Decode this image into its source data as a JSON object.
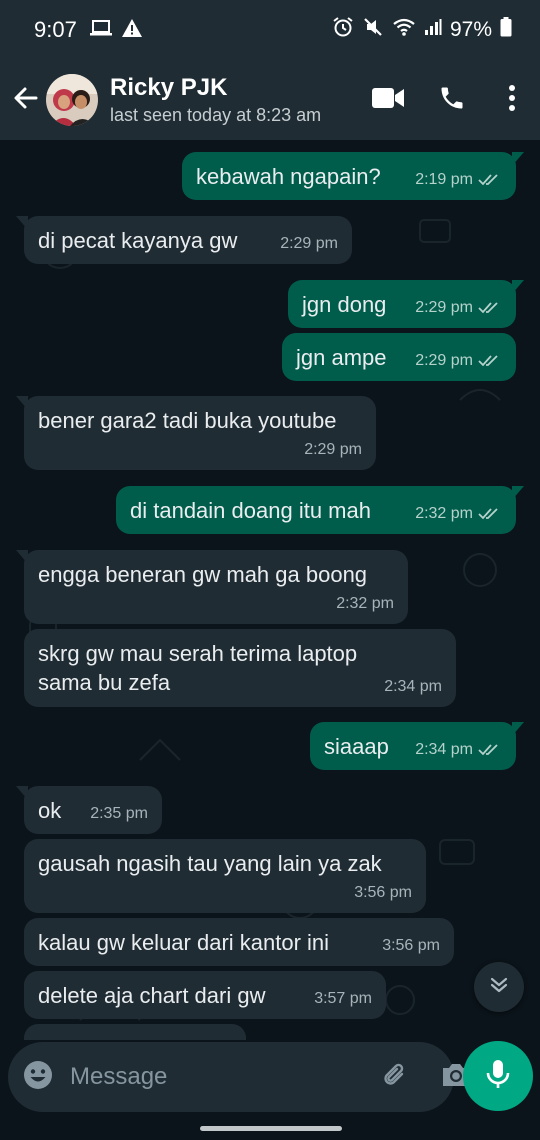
{
  "status_bar": {
    "time": "9:07",
    "battery": "97%"
  },
  "header": {
    "contact_name": "Ricky PJK",
    "last_seen": "last seen today at 8:23 am",
    "icons": {
      "back": "back-arrow-icon",
      "video": "video-call-icon",
      "call": "phone-icon",
      "menu": "more-vert-icon"
    }
  },
  "messages": [
    {
      "dir": "out",
      "text": "kebawah ngapain?",
      "time": "2:19 pm",
      "read": true
    },
    {
      "dir": "in",
      "text": "di pecat kayanya gw",
      "time": "2:29 pm"
    },
    {
      "dir": "out",
      "text": "jgn dong",
      "time": "2:29 pm",
      "read": true
    },
    {
      "dir": "out",
      "text": "jgn ampe",
      "time": "2:29 pm",
      "read": true
    },
    {
      "dir": "in",
      "text": "bener gara2 tadi buka youtube",
      "time": "2:29 pm"
    },
    {
      "dir": "out",
      "text": "di tandain doang itu mah",
      "time": "2:32 pm",
      "read": true
    },
    {
      "dir": "in",
      "text": "engga beneran gw mah ga boong",
      "time": "2:32 pm"
    },
    {
      "dir": "in",
      "text": "skrg gw mau serah terima laptop\nsama bu zefa",
      "time": "2:34 pm"
    },
    {
      "dir": "out",
      "text": "siaaap",
      "time": "2:34 pm",
      "read": true
    },
    {
      "dir": "in",
      "text": "ok",
      "time": "2:35 pm"
    },
    {
      "dir": "in",
      "text": "gausah ngasih tau yang lain ya zak",
      "time": "3:56 pm"
    },
    {
      "dir": "in",
      "text": "kalau gw keluar dari kantor ini",
      "time": "3:56 pm"
    },
    {
      "dir": "in",
      "text": "delete aja chart dari gw",
      "time": "3:57 pm"
    }
  ],
  "composer": {
    "placeholder": "Message"
  },
  "colors": {
    "incoming": "#202c33",
    "outgoing": "#005c4b",
    "accent": "#00a884",
    "read_tick": "#b5d2cb"
  }
}
